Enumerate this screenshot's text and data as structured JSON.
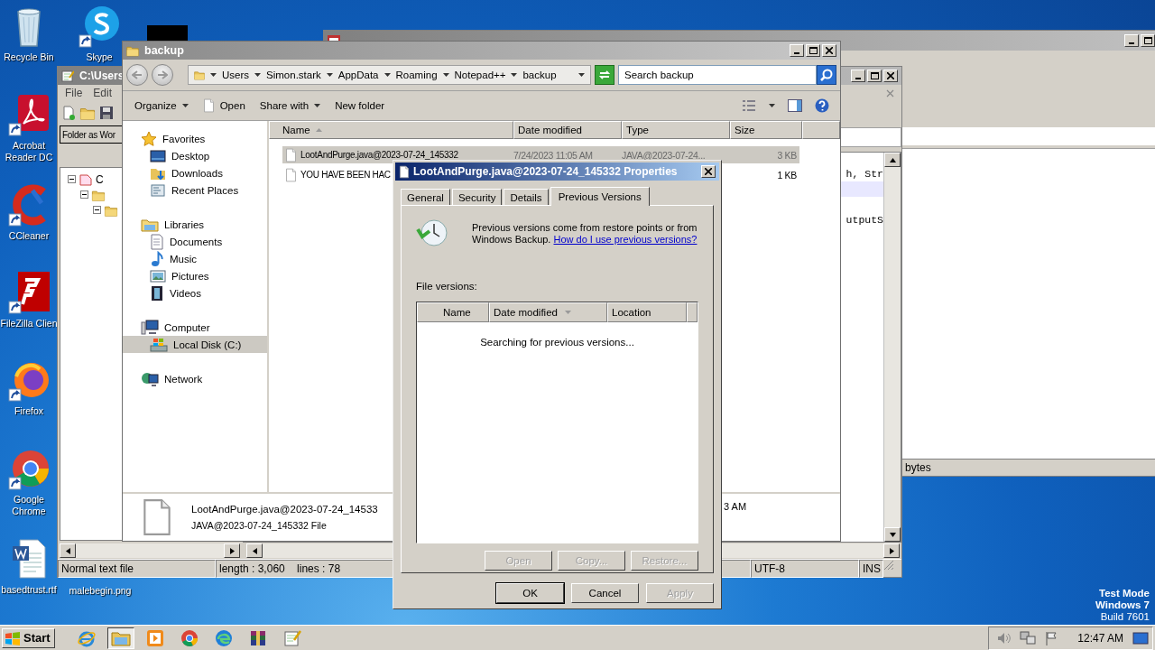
{
  "desktop": {
    "icons": [
      {
        "label": "Recycle Bin"
      },
      {
        "label": "Skype"
      },
      {
        "label": "Acrobat Reader DC"
      },
      {
        "label": "CCleaner"
      },
      {
        "label": "FileZilla Clien"
      },
      {
        "label": "Firefox"
      },
      {
        "label": "Google Chrome"
      },
      {
        "label": "basedtrust.rtf"
      },
      {
        "label": "malebegin.png"
      }
    ],
    "system_text": [
      "Test Mode",
      "Windows 7",
      "Build 7601"
    ]
  },
  "back_window": {
    "status_bar": "bytes"
  },
  "notepad_window": {
    "title": "C:\\Users",
    "menu": [
      "File",
      "Edit"
    ],
    "folder_panel": {
      "title": "Folder as Wor"
    },
    "tree": [
      {
        "label": "C",
        "expanded": true,
        "children": [
          {
            "expanded": true,
            "children": [
              {
                "expanded": true
              }
            ]
          }
        ]
      }
    ],
    "editor_lines": [
      {
        "text": "h, Str",
        "current": false
      },
      {
        "current": true
      },
      {
        "current": false
      },
      {
        "text": "utputS",
        "current": false
      }
    ],
    "status_bar": [
      "Normal text file",
      "length : 3,060    lines : 78",
      "UTF-8",
      "INS"
    ]
  },
  "explorer": {
    "title": "backup",
    "breadcrumbs": [
      "Users",
      "Simon.stark",
      "AppData",
      "Roaming",
      "Notepad++",
      "backup"
    ],
    "search": {
      "placeholder": "Search backup"
    },
    "toolbar": [
      {
        "label": "Organize",
        "kind": "menu"
      },
      {
        "label": "Open",
        "kind": "open"
      },
      {
        "label": "Share with",
        "kind": "menu"
      },
      {
        "label": "New folder",
        "kind": "plain"
      }
    ],
    "nav": [
      {
        "label": "Favorites",
        "selected": false,
        "children": [
          {
            "label": "Desktop",
            "selected": false
          },
          {
            "label": "Downloads",
            "selected": false
          },
          {
            "label": "Recent Places",
            "selected": false
          }
        ]
      },
      {
        "label": "Libraries",
        "selected": false,
        "children": [
          {
            "label": "Documents",
            "selected": false
          },
          {
            "label": "Music",
            "selected": false
          },
          {
            "label": "Pictures",
            "selected": false
          },
          {
            "label": "Videos",
            "selected": false
          }
        ]
      },
      {
        "label": "Computer",
        "selected": false,
        "children": [
          {
            "label": "Local Disk (C:)",
            "selected": true
          }
        ]
      },
      {
        "label": "Network",
        "selected": false
      }
    ],
    "columns": [
      {
        "label": "Name",
        "sorted": true
      },
      {
        "label": "Date modified",
        "sorted": false
      },
      {
        "label": "Type",
        "sorted": false
      },
      {
        "label": "Size",
        "sorted": false
      }
    ],
    "rows": [
      {
        "name": "LootAndPurge.java@2023-07-24_145332",
        "date_modified": "7/24/2023 11:05 AM",
        "type": "JAVA@2023-07-24...",
        "size": "3 KB",
        "selected": true
      },
      {
        "name": "YOU HAVE BEEN HAC",
        "size": "1 KB",
        "selected": false
      }
    ],
    "details_pane": {
      "name": "LootAndPurge.java@2023-07-24_14533",
      "type": "JAVA@2023-07-24_145332 File",
      "column_2": "3 AM"
    }
  },
  "properties": {
    "title": "LootAndPurge.java@2023-07-24_145332 Properties",
    "tabs": [
      {
        "label": "General",
        "selected": false
      },
      {
        "label": "Security",
        "selected": false
      },
      {
        "label": "Details",
        "selected": false
      },
      {
        "label": "Previous Versions",
        "selected": true
      }
    ],
    "info": {
      "text": "Previous versions come from restore points or from Windows Backup.",
      "link": "How do I use previous versions?"
    },
    "versions_label": "File versions:",
    "columns": [
      {
        "label": "Name",
        "sorted": false
      },
      {
        "label": "Date modified",
        "sorted": true
      },
      {
        "label": "Location",
        "sorted": false
      }
    ],
    "message": "Searching for previous versions...",
    "list_buttons": [
      {
        "label": "Open",
        "disabled": true
      },
      {
        "label": "Copy...",
        "disabled": true
      },
      {
        "label": "Restore...",
        "disabled": true
      }
    ],
    "buttons": [
      {
        "label": "OK",
        "disabled": false,
        "default": true
      },
      {
        "label": "Cancel",
        "disabled": false,
        "default": false
      },
      {
        "label": "Apply",
        "disabled": true,
        "default": false
      }
    ]
  },
  "taskbar": {
    "start": "Start",
    "apps": [
      {
        "selected": false
      },
      {
        "selected": true
      },
      {
        "selected": false
      },
      {
        "selected": false
      },
      {
        "selected": false
      },
      {
        "selected": false
      },
      {
        "selected": false
      }
    ],
    "clock": "12:47 AM"
  }
}
